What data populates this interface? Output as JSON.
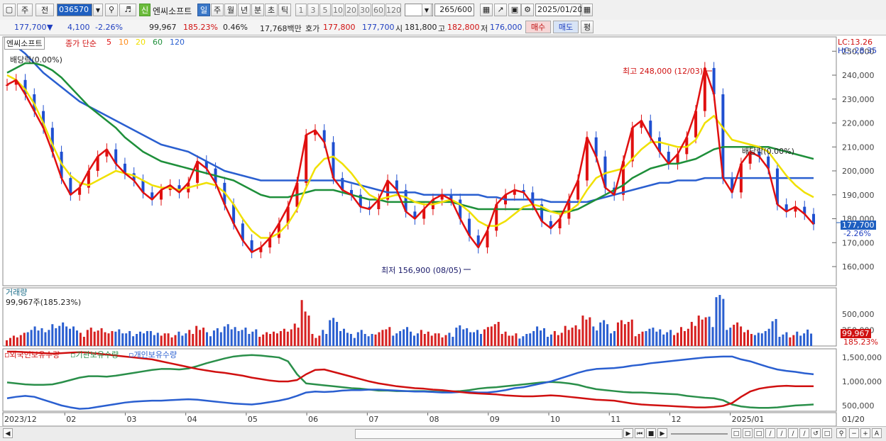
{
  "toolbar": {
    "period_main": "주",
    "prev_label": "전",
    "stock_code": "036570",
    "stock_name": "엔씨소프트",
    "new_badge": "신",
    "periods": [
      "일",
      "주",
      "월",
      "년",
      "분",
      "초",
      "틱"
    ],
    "active_period": "일",
    "minute_intervals": [
      "1",
      "3",
      "5",
      "10",
      "20",
      "30",
      "60",
      "120"
    ],
    "count_value": "265",
    "count_total": "/600",
    "date": "2025/01/20"
  },
  "quote": {
    "price": "177,700",
    "arrow": "▼",
    "change": "4,100",
    "change_pct": "-2.26%",
    "volume": "99,967",
    "volume_ratio": "185.23%",
    "turnover_pct": "0.46%",
    "amount": "17,768백만",
    "ask_label": "호가",
    "ask1": "177,800",
    "bid1": "177,700",
    "open_label": "시",
    "open": "181,800",
    "high_label": "고",
    "high": "182,800",
    "low_label": "저",
    "low": "176,000",
    "buy_button": "매수",
    "sell_button": "매도",
    "eval_button": "평"
  },
  "price_panel": {
    "stock_tag": "엔씨소프트",
    "ma_label": "종가 단순",
    "ma_periods": [
      {
        "period": "5",
        "color": "#e01010"
      },
      {
        "period": "10",
        "color": "#ff8c1a"
      },
      {
        "period": "20",
        "color": "#f0e000"
      },
      {
        "period": "60",
        "color": "#1e8f3a"
      },
      {
        "period": "120",
        "color": "#2a5fd0"
      }
    ],
    "lc": "LC:13.26",
    "hc": "HC:-28.35",
    "event_left": "배당락(0.00%)",
    "event_right": "배당락(0.00%)",
    "high_marker": "최고 248,000 (12/03)",
    "low_marker": "최저 156,900 (08/05)",
    "y_ticks": [
      "250,000",
      "240,000",
      "230,000",
      "220,000",
      "210,000",
      "200,000",
      "190,000",
      "180,000",
      "170,000",
      "160,000"
    ],
    "current_price": "177,700",
    "current_pct": "-2.26%"
  },
  "volume_panel": {
    "title": "거래량",
    "value_label": "99,967주(185.23%)",
    "y_ticks": [
      "500,000",
      "250,000"
    ],
    "current": "99,967",
    "current_pct": "185.23%"
  },
  "holding_panel": {
    "series": [
      {
        "name": "외국인보유수량",
        "color": "#d01010"
      },
      {
        "name": "기관보유수량",
        "color": "#2a8f4a"
      },
      {
        "name": "개인보유수량",
        "color": "#2a5fd0"
      }
    ],
    "y_ticks": [
      "1,500,000",
      "1,000,000",
      "500,000"
    ]
  },
  "x_axis": [
    "2023/12",
    "02",
    "03",
    "04",
    "05",
    "06",
    "07",
    "08",
    "09",
    "10",
    "11",
    "12",
    "2025/01",
    "01/20"
  ],
  "chart_data": {
    "type": "line",
    "title": "",
    "xlabel": "",
    "ylabel": "",
    "ylim": [
      152000,
      256000
    ],
    "price_close": [
      236000,
      238000,
      232000,
      225000,
      218000,
      208000,
      197000,
      190000,
      193000,
      200000,
      206000,
      209000,
      203000,
      199000,
      196000,
      191000,
      188000,
      192000,
      194000,
      191000,
      195000,
      204000,
      201000,
      195000,
      186000,
      178000,
      171000,
      166000,
      168000,
      172000,
      178000,
      185000,
      195000,
      215000,
      217000,
      212000,
      197000,
      192000,
      190000,
      185000,
      184000,
      188000,
      196000,
      192000,
      183000,
      180000,
      184000,
      188000,
      190000,
      188000,
      180000,
      173000,
      168000,
      175000,
      186000,
      190000,
      192000,
      191000,
      186000,
      179000,
      176000,
      180000,
      188000,
      196000,
      214000,
      206000,
      193000,
      190000,
      204000,
      218000,
      221000,
      214000,
      208000,
      203000,
      207000,
      214000,
      225000,
      243000,
      232000,
      197000,
      191000,
      203000,
      208000,
      206000,
      201000,
      186000,
      183000,
      185000,
      182000,
      177700
    ],
    "ma20": [
      240000,
      238000,
      234000,
      228000,
      220000,
      211000,
      203000,
      198000,
      195000,
      194000,
      196000,
      198000,
      200000,
      199000,
      198000,
      196000,
      194000,
      193000,
      193000,
      192000,
      193000,
      194000,
      195000,
      194000,
      191000,
      186000,
      180000,
      175000,
      172000,
      172000,
      174000,
      178000,
      184000,
      193000,
      201000,
      205000,
      206000,
      203000,
      199000,
      194000,
      190000,
      188000,
      189000,
      190000,
      189000,
      187000,
      186000,
      186000,
      187000,
      188000,
      186000,
      183000,
      179000,
      177000,
      177000,
      179000,
      182000,
      185000,
      186000,
      185000,
      183000,
      182000,
      183000,
      186000,
      192000,
      197000,
      199000,
      200000,
      201000,
      205000,
      209000,
      212000,
      212000,
      211000,
      210000,
      210000,
      213000,
      220000,
      223000,
      218000,
      213000,
      212000,
      211000,
      210000,
      208000,
      203000,
      198000,
      194000,
      191000,
      189000
    ],
    "ma60": [
      241000,
      243000,
      245000,
      245000,
      244000,
      242000,
      239000,
      235000,
      231000,
      227000,
      224000,
      221000,
      218000,
      214000,
      211000,
      208000,
      206000,
      204000,
      203000,
      202000,
      201000,
      200000,
      199000,
      198000,
      197000,
      196000,
      194000,
      192000,
      190000,
      189000,
      189000,
      189000,
      190000,
      191000,
      192000,
      192000,
      192000,
      191000,
      190000,
      189000,
      188000,
      188000,
      187000,
      187000,
      187000,
      187000,
      187000,
      187000,
      187000,
      187000,
      186000,
      185000,
      184000,
      184000,
      184000,
      184000,
      184000,
      184000,
      184000,
      184000,
      183000,
      183000,
      183000,
      184000,
      186000,
      188000,
      190000,
      192000,
      194000,
      197000,
      199000,
      201000,
      202000,
      203000,
      203000,
      204000,
      205000,
      207000,
      209000,
      210000,
      210000,
      210000,
      210000,
      210000,
      210000,
      209000,
      208000,
      207000,
      206000,
      205000
    ],
    "ma120": [
      255000,
      252000,
      249000,
      245000,
      241000,
      238000,
      235000,
      232000,
      229000,
      227000,
      225000,
      223000,
      221000,
      219000,
      217000,
      215000,
      213000,
      211000,
      210000,
      209000,
      208000,
      206000,
      204000,
      202000,
      200000,
      199000,
      198000,
      197000,
      196000,
      196000,
      196000,
      196000,
      196000,
      196000,
      196000,
      196000,
      196000,
      196000,
      195000,
      194000,
      193000,
      192000,
      191000,
      191000,
      191000,
      191000,
      190000,
      190000,
      190000,
      190000,
      190000,
      190000,
      190000,
      189000,
      189000,
      188000,
      188000,
      188000,
      188000,
      188000,
      187000,
      187000,
      187000,
      187000,
      187000,
      188000,
      189000,
      190000,
      191000,
      192000,
      193000,
      194000,
      195000,
      195000,
      196000,
      196000,
      196000,
      197000,
      197000,
      197000,
      197000,
      197000,
      197000,
      197000,
      197000,
      197000,
      197000,
      197000,
      197000,
      197000
    ],
    "foreign_holding": [
      1620000,
      1620000,
      1610000,
      1600000,
      1590000,
      1580000,
      1590000,
      1600000,
      1610000,
      1600000,
      1580000,
      1560000,
      1540000,
      1520000,
      1500000,
      1480000,
      1460000,
      1420000,
      1380000,
      1340000,
      1300000,
      1260000,
      1230000,
      1200000,
      1180000,
      1150000,
      1120000,
      1080000,
      1050000,
      1020000,
      1000000,
      1000000,
      1030000,
      1150000,
      1240000,
      1250000,
      1200000,
      1150000,
      1100000,
      1050000,
      1000000,
      960000,
      930000,
      900000,
      880000,
      860000,
      850000,
      830000,
      820000,
      800000,
      780000,
      760000,
      750000,
      740000,
      730000,
      710000,
      700000,
      690000,
      690000,
      700000,
      710000,
      700000,
      680000,
      660000,
      640000,
      620000,
      610000,
      600000,
      570000,
      540000,
      520000,
      510000,
      500000,
      490000,
      480000,
      470000,
      460000,
      460000,
      470000,
      490000,
      550000,
      680000,
      790000,
      850000,
      880000,
      900000,
      910000,
      900000,
      900000,
      900000
    ],
    "institution_holding": [
      980000,
      960000,
      940000,
      930000,
      930000,
      940000,
      980000,
      1030000,
      1080000,
      1110000,
      1110000,
      1100000,
      1120000,
      1150000,
      1180000,
      1210000,
      1240000,
      1260000,
      1260000,
      1250000,
      1270000,
      1320000,
      1380000,
      1430000,
      1480000,
      1520000,
      1540000,
      1550000,
      1540000,
      1520000,
      1500000,
      1420000,
      1150000,
      960000,
      940000,
      920000,
      900000,
      880000,
      860000,
      850000,
      830000,
      810000,
      810000,
      800000,
      800000,
      800000,
      800000,
      790000,
      780000,
      790000,
      800000,
      820000,
      850000,
      870000,
      880000,
      900000,
      920000,
      940000,
      960000,
      980000,
      990000,
      980000,
      960000,
      930000,
      880000,
      840000,
      820000,
      800000,
      780000,
      770000,
      770000,
      760000,
      750000,
      740000,
      730000,
      700000,
      680000,
      660000,
      650000,
      610000,
      520000,
      480000,
      460000,
      450000,
      450000,
      460000,
      480000,
      500000,
      510000,
      520000
    ],
    "individual_holding": [
      650000,
      680000,
      700000,
      680000,
      620000,
      560000,
      500000,
      460000,
      430000,
      440000,
      470000,
      500000,
      530000,
      560000,
      580000,
      590000,
      600000,
      600000,
      610000,
      620000,
      630000,
      620000,
      600000,
      580000,
      560000,
      540000,
      530000,
      520000,
      540000,
      570000,
      600000,
      640000,
      700000,
      770000,
      790000,
      780000,
      790000,
      810000,
      820000,
      820000,
      830000,
      830000,
      820000,
      810000,
      800000,
      790000,
      790000,
      780000,
      770000,
      770000,
      780000,
      780000,
      770000,
      770000,
      790000,
      820000,
      860000,
      880000,
      920000,
      960000,
      1000000,
      1060000,
      1120000,
      1180000,
      1230000,
      1260000,
      1270000,
      1280000,
      1300000,
      1330000,
      1350000,
      1380000,
      1400000,
      1420000,
      1440000,
      1460000,
      1480000,
      1500000,
      1510000,
      1520000,
      1520000,
      1460000,
      1420000,
      1360000,
      1300000,
      1250000,
      1220000,
      1200000,
      1170000,
      1150000
    ]
  }
}
